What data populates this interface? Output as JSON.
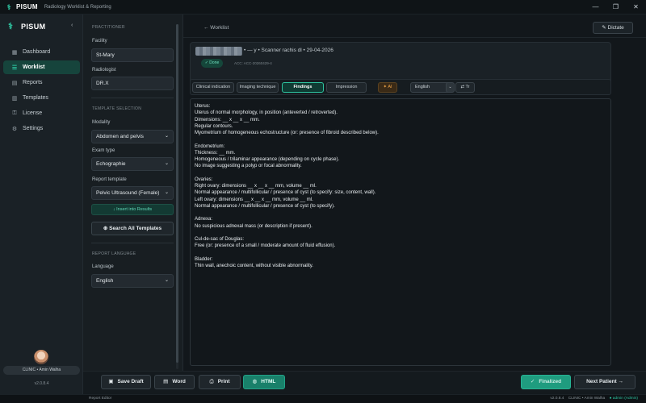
{
  "window": {
    "app_name": "PISUM",
    "subtitle": "Radiology Worklist & Reporting",
    "minimize": "—",
    "maximize": "❐",
    "close": "✕"
  },
  "sidebar": {
    "brand": "PISUM",
    "collapse_icon": "chevron-left-icon",
    "items": [
      {
        "label": "Dashboard",
        "icon": "grid-icon",
        "active": false
      },
      {
        "label": "Worklist",
        "icon": "list-icon",
        "active": true
      },
      {
        "label": "Reports",
        "icon": "file-icon",
        "active": false
      },
      {
        "label": "Templates",
        "icon": "template-icon",
        "active": false
      },
      {
        "label": "License",
        "icon": "key-icon",
        "active": false
      },
      {
        "label": "Settings",
        "icon": "gear-icon",
        "active": false
      }
    ],
    "user": "CLINIC • Amin Walha",
    "version": "v2.0.8.4"
  },
  "panel": {
    "practitioner_title": "PRACTITIONER",
    "facility_label": "Facility",
    "facility_value": "St-Mary",
    "radiologist_label": "Radiologist",
    "radiologist_value": "DR.X",
    "template_title": "TEMPLATE SELECTION",
    "modality_label": "Modality",
    "modality_value": "Abdomen and pelvis",
    "exam_label": "Exam type",
    "exam_value": "Echographie",
    "report_label": "Report template",
    "report_value": "Pelvic Ultrasound (Female)",
    "insert_button": "↓ Insert into Results",
    "search_button": "Search All Templates",
    "language_title": "REPORT LANGUAGE",
    "language_label": "Language",
    "language_value": "English"
  },
  "main": {
    "back": "← Worklist",
    "dictate": "Dictate",
    "patient_meta": "• — y • Scanner rachis dl • 29-04-2026",
    "status": "✓ Done",
    "accession": "ACC: ACC-20260429-4",
    "tabs": [
      "Clinical indication",
      "Imaging technique",
      "Findings",
      "Impression"
    ],
    "active_tab": "Findings",
    "ai_button": "✦ AI",
    "language": "English",
    "translate_button": "⇄ Tr",
    "editor_lines": [
      "Uterus:",
      "Uterus of normal morphology, in position (anteverted / retroverted).",
      "Dimensions: __ x __ x __ mm.",
      "Regular contours.",
      "Myometrium of homogeneous echostructure (or: presence of fibroid described below).",
      "",
      "Endometrium:",
      "Thickness: __ mm.",
      "Homogeneous / trilaminar appearance (depending on cycle phase).",
      "No image suggesting a polyp or focal abnormality.",
      "",
      "Ovaries:",
      "Right ovary: dimensions __ x __ x __ mm, volume __ ml.",
      "Normal appearance / multifollicular / presence of cyst (to specify: size, content, wall).",
      "Left ovary: dimensions __ x __ x __ mm, volume __ ml.",
      "Normal appearance / multifollicular / presence of cyst (to specify).",
      "",
      "Adnexa:",
      "No suspicious adnexal mass (or description if present).",
      "",
      "Cul-de-sac of Douglas:",
      "Free (or: presence of a small / moderate amount of fluid effusion).",
      "",
      "Bladder:",
      "Thin wall, anechoic content, without visible abnormality."
    ]
  },
  "actions": {
    "save_draft": "Save Draft",
    "word": "Word",
    "print": "Print",
    "html": "HTML",
    "finalize": "Finalized",
    "next_patient": "Next Patient →"
  },
  "statusbar": {
    "left": "Report Editor",
    "version": "v2.0.8.4",
    "clinic": "CLINIC • Amin Walha",
    "admin": "● admin (Admin)"
  },
  "colors": {
    "accent": "#2ec4a0",
    "background": "#12171b",
    "sidebar": "#1a2126",
    "ai": "#f0a64a"
  }
}
